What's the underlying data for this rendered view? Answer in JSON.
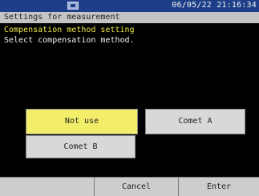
{
  "status_bar": {
    "icon": "memory-card-icon",
    "datetime": "06/05/22 21:16:34"
  },
  "title_bar": {
    "title": "Settings for measurement"
  },
  "instructions": {
    "heading": "Compensation method setting",
    "description": "Select compensation method."
  },
  "options": {
    "not_use": "Not use",
    "comet_a": "Comet  A",
    "comet_b": "Comet  B",
    "selected": "Not use"
  },
  "softkeys": {
    "key1": "",
    "cancel": "Cancel",
    "enter": "Enter"
  },
  "colors": {
    "status_bar": "#1d3f8a",
    "selected_option": "#f3ee6a",
    "heading_text": "#f0e84a"
  }
}
